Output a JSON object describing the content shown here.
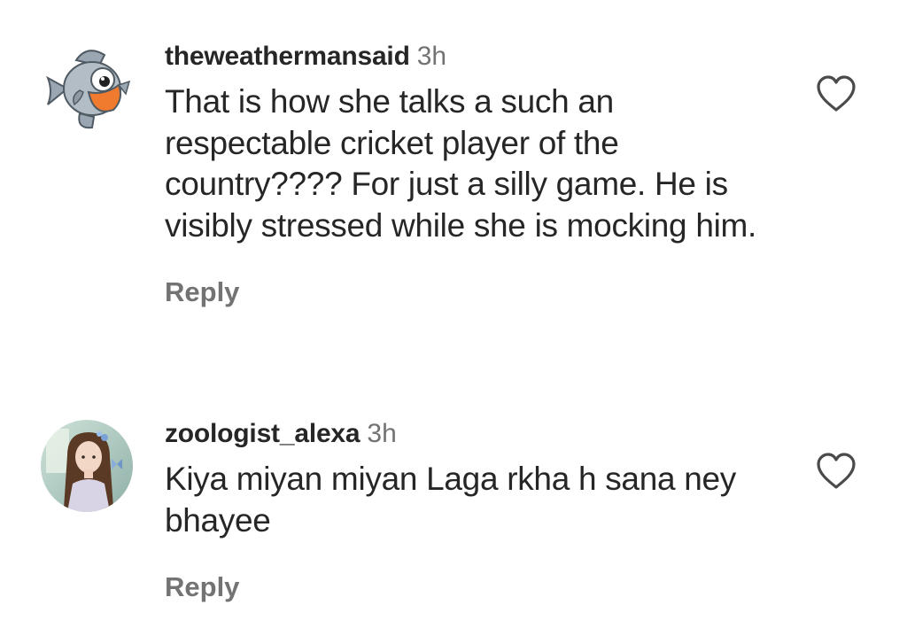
{
  "comments": [
    {
      "username": "theweathermansaid",
      "time": "3h",
      "text": "That is how she talks a such an respectable cricket player of the country???? For just a silly game. He is visibly stressed while she is mocking him.",
      "reply_label": "Reply",
      "avatar_icon": "fish-cartoon-avatar",
      "like_icon": "heart-outline-icon"
    },
    {
      "username": "zoologist_alexa",
      "time": "3h",
      "text": "Kiya miyan miyan Laga rkha h sana ney bhayee",
      "reply_label": "Reply",
      "avatar_icon": "girl-portrait-avatar",
      "like_icon": "heart-outline-icon"
    }
  ],
  "colors": {
    "primary_text": "#262626",
    "secondary_text": "#737373",
    "background": "#ffffff"
  }
}
